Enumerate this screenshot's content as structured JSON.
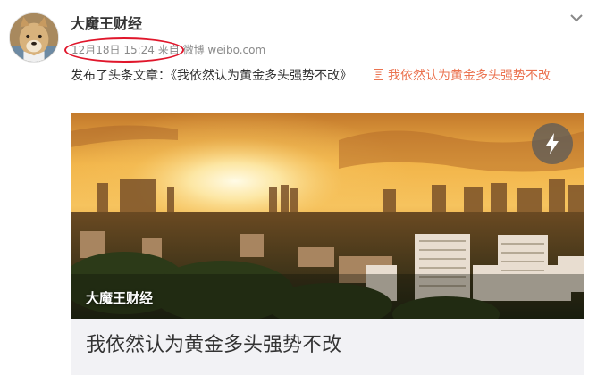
{
  "post": {
    "username": "大魔王财经",
    "timestamp": "12月18日 15:24",
    "source_prefix": "来自",
    "source": "微博 weibo.com",
    "text": "发布了头条文章：《我依然认为黄金多头强势不改》",
    "article_link": "我依然认为黄金多头强势不改",
    "avatar_icon": "dog-avatar-icon",
    "more_icon": "chevron-down-icon",
    "link_icon": "article-doc-icon"
  },
  "card": {
    "overlay_title": "大魔王财经",
    "title": "我依然认为黄金多头强势不改",
    "badge_icon": "lightning-bolt-icon"
  },
  "colors": {
    "link": "#eb7350",
    "annotation": "#e0162b",
    "meta": "#8a8a8a",
    "card_footer": "#f2f2f5"
  }
}
